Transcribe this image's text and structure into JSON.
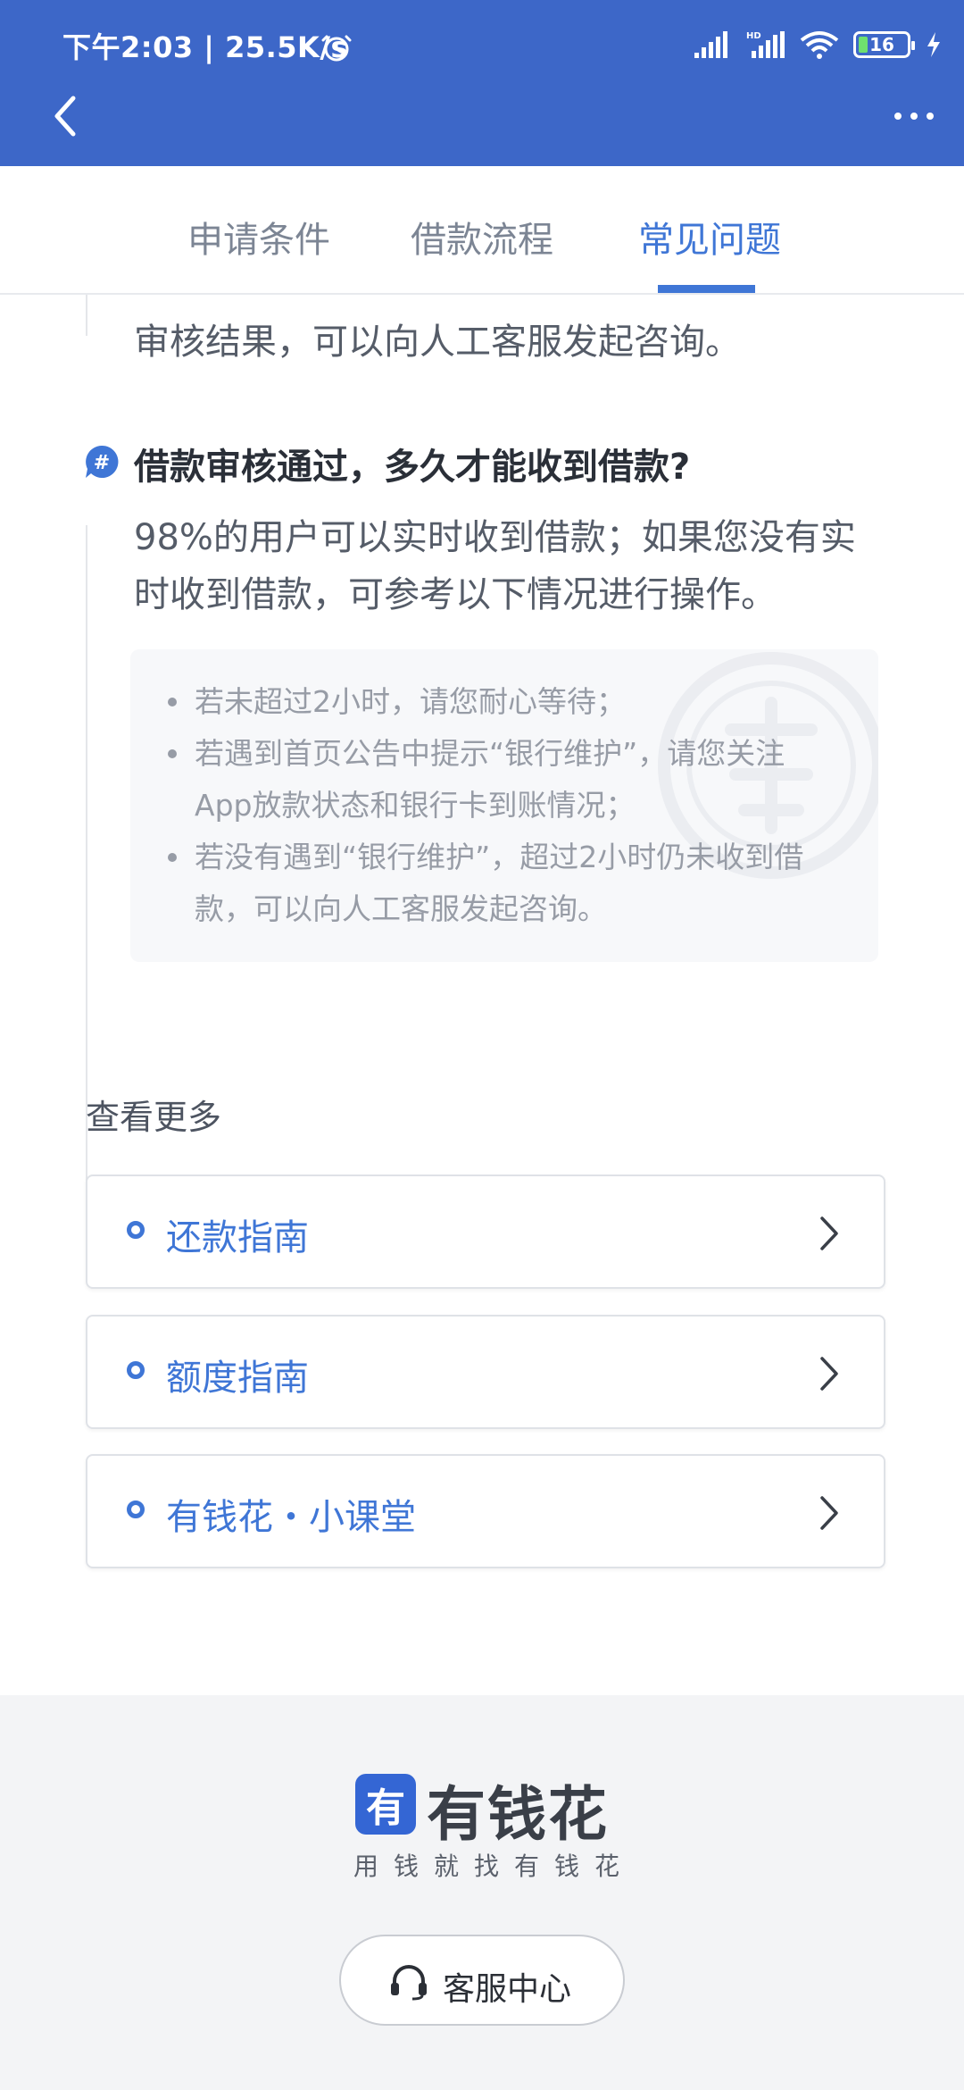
{
  "status_bar": {
    "time_speed": "下午2:03 | 25.5K/s",
    "hd_label": "HD",
    "battery": "16"
  },
  "tabs": [
    {
      "label": "申请条件",
      "active": false
    },
    {
      "label": "借款流程",
      "active": false
    },
    {
      "label": "常见问题",
      "active": true
    }
  ],
  "faq": {
    "previous_answer_tail": "审核结果，可以向人工客服发起咨询。",
    "question": "借款审核通过，多久才能收到借款?",
    "answer_lines": [
      "98%的用户可以实时收到借款；如果您没有实",
      "时收到借款，可参考以下情况进行操作。"
    ],
    "tips": [
      {
        "lines": [
          "若未超过2小时，请您耐心等待；"
        ]
      },
      {
        "lines": [
          "若遇到首页公告中提示“银行维护”，请您关注",
          "App放款状态和银行卡到账情况；"
        ]
      },
      {
        "lines": [
          "若没有遇到“银行维护”，超过2小时仍未收到借",
          "款，可以向人工客服发起咨询。"
        ]
      }
    ]
  },
  "more": {
    "title": "查看更多",
    "items": [
      {
        "label": "还款指南"
      },
      {
        "label": "额度指南"
      },
      {
        "label": "有钱花・小课堂"
      }
    ]
  },
  "footer": {
    "logo_mark": "有",
    "logo_text": "有钱花",
    "slogan": "用钱就找有钱花",
    "service_label": "客服中心"
  },
  "colors": {
    "header": "#3d67c8",
    "accent": "#3f76d6"
  }
}
